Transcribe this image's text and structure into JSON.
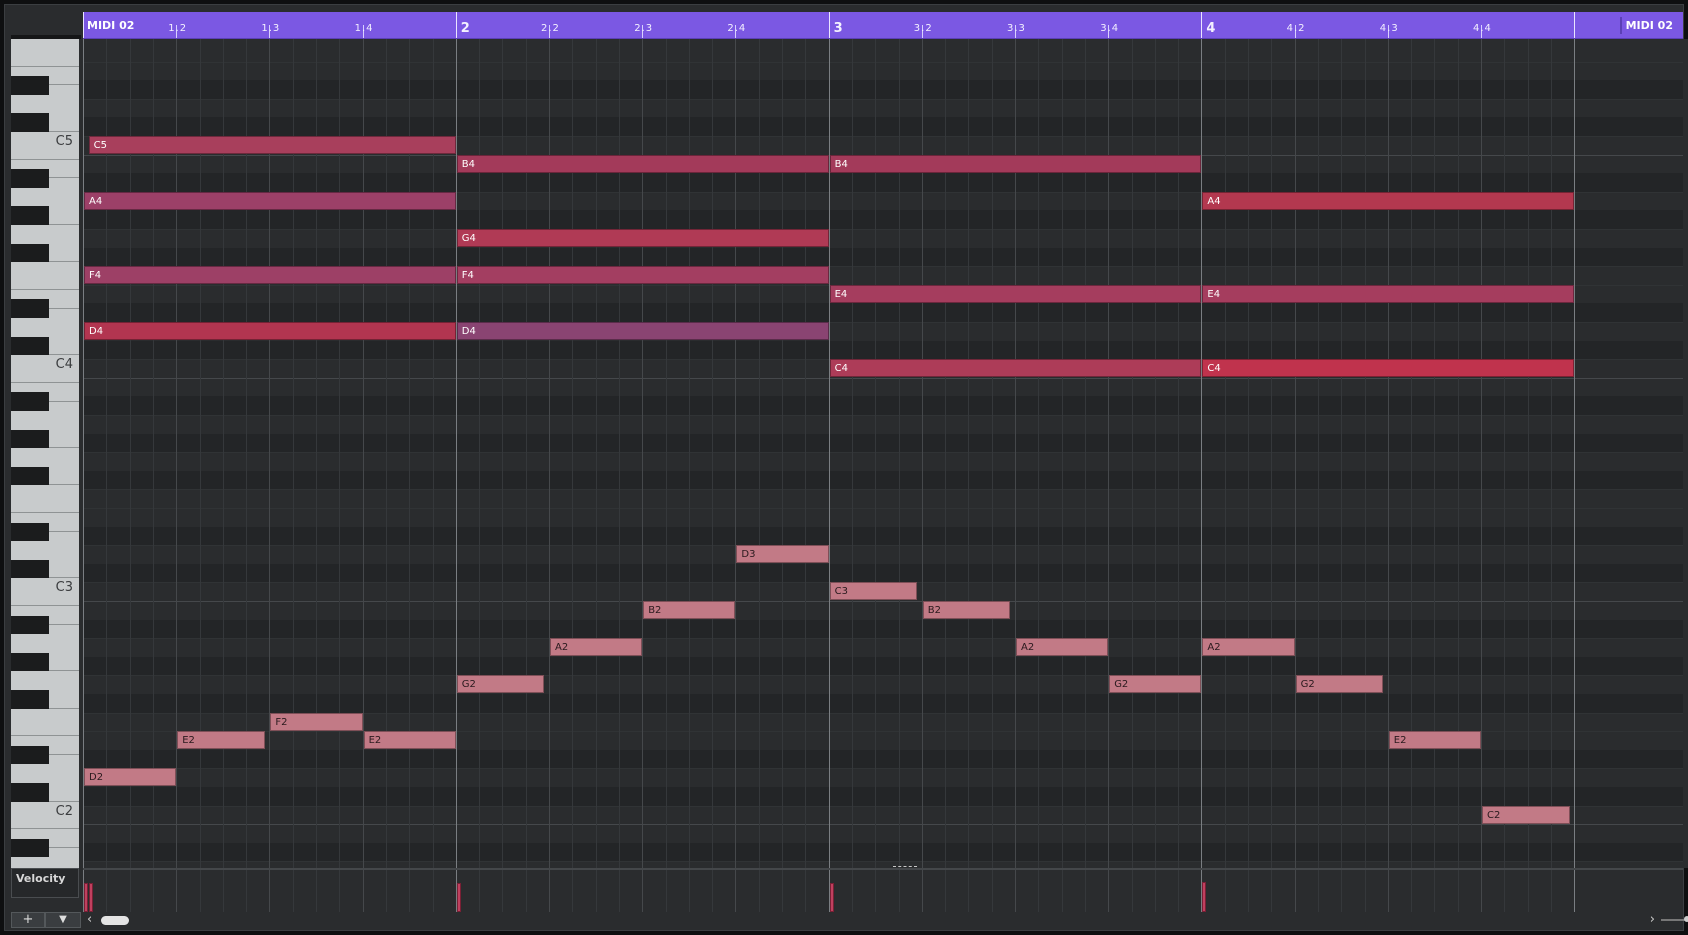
{
  "ruler": {
    "part_left": "MIDI 02",
    "part_right": "MIDI 02",
    "bars": [
      {
        "label": "2",
        "beat": 4
      },
      {
        "label": "3",
        "beat": 8
      },
      {
        "label": "4",
        "beat": 12
      }
    ],
    "beat_labels": [
      {
        "label": "1.2",
        "beat": 1
      },
      {
        "label": "1.3",
        "beat": 2
      },
      {
        "label": "1.4",
        "beat": 3
      },
      {
        "label": "2.2",
        "beat": 5
      },
      {
        "label": "2.3",
        "beat": 6
      },
      {
        "label": "2.4",
        "beat": 7
      },
      {
        "label": "3.2",
        "beat": 9
      },
      {
        "label": "3.3",
        "beat": 10
      },
      {
        "label": "3.4",
        "beat": 11
      },
      {
        "label": "4.2",
        "beat": 13
      },
      {
        "label": "4.3",
        "beat": 14
      },
      {
        "label": "4.4",
        "beat": 15
      }
    ]
  },
  "keyboard": {
    "octave_labels": [
      {
        "label": "C5",
        "pitch": 72
      },
      {
        "label": "C4",
        "pitch": 60
      },
      {
        "label": "C3",
        "pitch": 48
      },
      {
        "label": "C2",
        "pitch": 36
      }
    ],
    "top_pitch": 77,
    "bottom_pitch": 34
  },
  "notes": [
    {
      "label": "C5",
      "pitch": 72,
      "start": 0.05,
      "length": 3.95,
      "color": "#a83f5c"
    },
    {
      "label": "B4",
      "pitch": 71,
      "start": 4,
      "length": 4,
      "color": "#a33a5a"
    },
    {
      "label": "B4",
      "pitch": 71,
      "start": 8,
      "length": 4,
      "color": "#a33a5a"
    },
    {
      "label": "A4",
      "pitch": 69,
      "start": 0,
      "length": 4,
      "color": "#9c4068"
    },
    {
      "label": "A4",
      "pitch": 69,
      "start": 12,
      "length": 4,
      "color": "#b3384f"
    },
    {
      "label": "G4",
      "pitch": 67,
      "start": 4,
      "length": 4,
      "color": "#b03a55"
    },
    {
      "label": "F4",
      "pitch": 65,
      "start": 0,
      "length": 4,
      "color": "#9d4066"
    },
    {
      "label": "F4",
      "pitch": 65,
      "start": 4,
      "length": 4,
      "color": "#a33e61"
    },
    {
      "label": "E4",
      "pitch": 64,
      "start": 8,
      "length": 4,
      "color": "#a53d5e"
    },
    {
      "label": "E4",
      "pitch": 64,
      "start": 12,
      "length": 4,
      "color": "#a53d5e"
    },
    {
      "label": "D4",
      "pitch": 62,
      "start": 0,
      "length": 4,
      "color": "#b23550"
    },
    {
      "label": "D4",
      "pitch": 62,
      "start": 4,
      "length": 4,
      "color": "#8a4472"
    },
    {
      "label": "C4",
      "pitch": 60,
      "start": 8,
      "length": 4,
      "color": "#ad3c58"
    },
    {
      "label": "C4",
      "pitch": 60,
      "start": 12,
      "length": 4,
      "color": "#c0334d"
    },
    {
      "label": "D3",
      "pitch": 50,
      "start": 7,
      "length": 1,
      "color": "#c27a86"
    },
    {
      "label": "C3",
      "pitch": 48,
      "start": 8,
      "length": 0.95,
      "color": "#c27a86"
    },
    {
      "label": "B2",
      "pitch": 47,
      "start": 6,
      "length": 1,
      "color": "#c27a86"
    },
    {
      "label": "B2",
      "pitch": 47,
      "start": 9,
      "length": 0.95,
      "color": "#c27a86"
    },
    {
      "label": "A2",
      "pitch": 45,
      "start": 5,
      "length": 1,
      "color": "#c27a86"
    },
    {
      "label": "A2",
      "pitch": 45,
      "start": 10,
      "length": 1,
      "color": "#c27a86"
    },
    {
      "label": "A2",
      "pitch": 45,
      "start": 12,
      "length": 1,
      "color": "#c27a86"
    },
    {
      "label": "G2",
      "pitch": 43,
      "start": 4,
      "length": 0.95,
      "color": "#c27a86"
    },
    {
      "label": "G2",
      "pitch": 43,
      "start": 11,
      "length": 1,
      "color": "#c27a86"
    },
    {
      "label": "G2",
      "pitch": 43,
      "start": 13,
      "length": 0.95,
      "color": "#c27a86"
    },
    {
      "label": "F2",
      "pitch": 41,
      "start": 2,
      "length": 1,
      "color": "#c27a86"
    },
    {
      "label": "E2",
      "pitch": 40,
      "start": 1,
      "length": 0.95,
      "color": "#c27a86"
    },
    {
      "label": "E2",
      "pitch": 40,
      "start": 3,
      "length": 1,
      "color": "#c27a86"
    },
    {
      "label": "E2",
      "pitch": 40,
      "start": 14,
      "length": 1,
      "color": "#c27a86"
    },
    {
      "label": "D2",
      "pitch": 38,
      "start": 0,
      "length": 1,
      "color": "#c27a86"
    },
    {
      "label": "C2",
      "pitch": 36,
      "start": 15,
      "length": 0.96,
      "color": "#c27a86"
    }
  ],
  "velocity": {
    "label": "Velocity",
    "events": [
      {
        "beat": 0,
        "value": 0.68
      },
      {
        "beat": 0.05,
        "value": 0.68
      },
      {
        "beat": 4,
        "value": 0.68
      },
      {
        "beat": 8,
        "value": 0.68
      },
      {
        "beat": 12,
        "value": 0.72
      }
    ]
  },
  "bottom_bar": {
    "add_symbol": "+",
    "menu_symbol": "▼",
    "scroll_left": "‹",
    "scroll_right": "›"
  },
  "colors": {
    "ruler": "#7b58e3",
    "grid_bg": "#2a2c2e",
    "note_high": "#a83f5c",
    "note_low": "#c27a86"
  }
}
